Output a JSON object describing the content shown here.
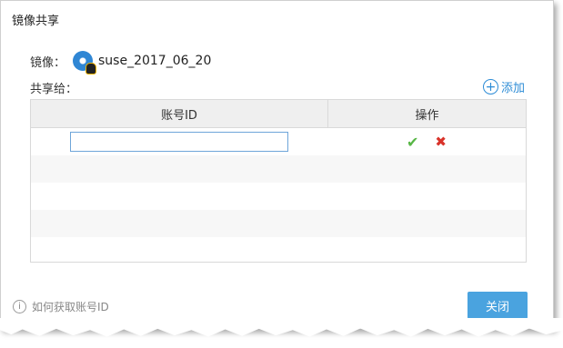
{
  "dialog": {
    "title": "镜像共享"
  },
  "image": {
    "label": "镜像：",
    "name": "suse_2017_06_20",
    "icon": "disc-linux-icon"
  },
  "share": {
    "label": "共享给：",
    "add_label": "添加",
    "add_icon": "plus-circle-icon"
  },
  "table": {
    "columns": [
      "账号ID",
      "操作"
    ],
    "input_value": "",
    "actions": {
      "confirm": "✔",
      "cancel": "✖"
    }
  },
  "footer": {
    "help_text": "如何获取账号ID",
    "help_icon": "info-icon",
    "close_label": "关闭"
  },
  "colors": {
    "accent": "#4aa3df",
    "confirm": "#57b646",
    "cancel": "#d9332a"
  }
}
